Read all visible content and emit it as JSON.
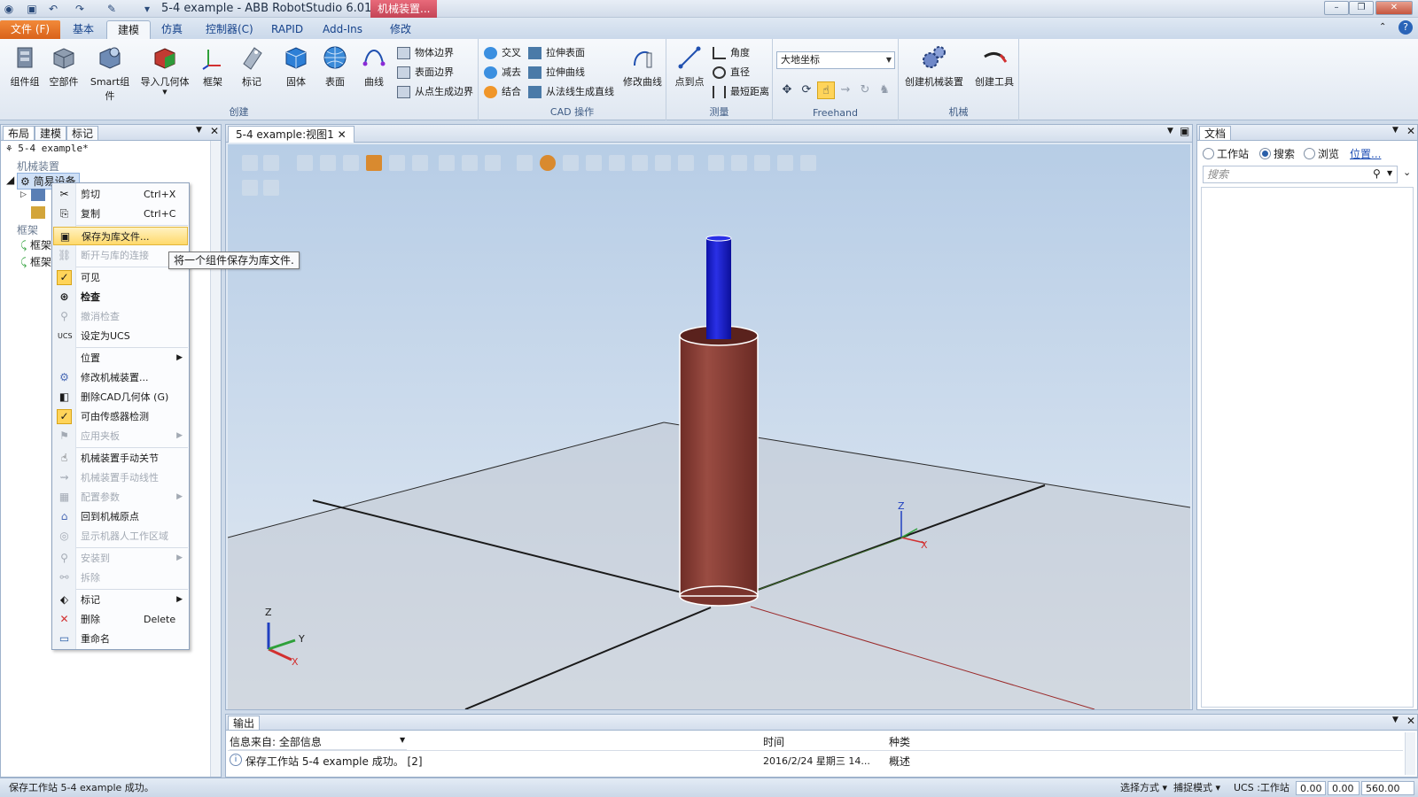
{
  "window": {
    "title": "5-4 example - ABB RobotStudio 6.01.01",
    "context_tab": "机械装置...",
    "buttons": [
      "–",
      "❐",
      "✕"
    ]
  },
  "ribbon_tabs": [
    "文件 (F)",
    "基本",
    "建模",
    "仿真",
    "控制器(C)",
    "RAPID",
    "Add-Ins",
    "修改"
  ],
  "ribbon": {
    "create": {
      "label": "创建",
      "big_buttons": [
        "组件组",
        "空部件",
        "Smart组件",
        "导入几何体",
        "框架",
        "标记"
      ]
    },
    "cad": {
      "label": "CAD 操作",
      "big_buttons": [
        "固体",
        "表面",
        "曲线"
      ],
      "small_col1": [
        "物体边界",
        "表面边界",
        "从点生成边界"
      ],
      "small_col2": [
        "交叉",
        "减去",
        "结合"
      ],
      "small_col3": [
        "拉伸表面",
        "拉伸曲线",
        "从法线生成直线"
      ],
      "modify_curve": "修改曲线"
    },
    "measure": {
      "label": "测量",
      "point_to_point": "点到点",
      "small": [
        "角度",
        "直径",
        "最短距离"
      ]
    },
    "freehand": {
      "label": "Freehand",
      "coord_select": "大地坐标"
    },
    "mechanism": {
      "label": "机械",
      "buttons": [
        "创建机械装置",
        "创建工具"
      ]
    }
  },
  "left_panel": {
    "tabs": [
      "布局",
      "建模",
      "标记"
    ],
    "tree": {
      "station": "5-4 example*",
      "mechanisms": "机械装置",
      "selected": "简易设备",
      "frames": "框架",
      "frame1": "框架",
      "frame2": "框架"
    }
  },
  "context_menu": {
    "items": [
      {
        "label": "剪切",
        "shortcut": "Ctrl+X"
      },
      {
        "label": "复制",
        "shortcut": "Ctrl+C"
      },
      {
        "label": "保存为库文件..."
      },
      {
        "label": "断开与库的连接"
      },
      {
        "label": "可见"
      },
      {
        "label": "检查"
      },
      {
        "label": "撤消检查"
      },
      {
        "label": "设定为UCS"
      },
      {
        "label": "位置"
      },
      {
        "label": "修改机械装置..."
      },
      {
        "label": "删除CAD几何体 (G)"
      },
      {
        "label": "可由传感器检测"
      },
      {
        "label": "应用夹板"
      },
      {
        "label": "机械装置手动关节"
      },
      {
        "label": "机械装置手动线性"
      },
      {
        "label": "配置参数"
      },
      {
        "label": "回到机械原点"
      },
      {
        "label": "显示机器人工作区域"
      },
      {
        "label": "安装到"
      },
      {
        "label": "拆除"
      },
      {
        "label": "标记"
      },
      {
        "label": "删除",
        "shortcut": "Delete"
      },
      {
        "label": "重命名"
      }
    ],
    "tooltip": "将一个组件保存为库文件."
  },
  "viewport": {
    "tab": "5-4 example:视图1",
    "axes_small": {
      "x": "X",
      "y": "Y",
      "z": "Z"
    },
    "axes_world": {
      "x": "X",
      "z": "Z"
    }
  },
  "right_panel": {
    "title": "文档",
    "radios": [
      "工作站",
      "搜索",
      "浏览"
    ],
    "selected_radio": "搜索",
    "location_link": "位置...",
    "search_placeholder": "搜索"
  },
  "output": {
    "title": "输出",
    "filter_label": "信息来自: 全部信息",
    "columns": [
      "时间",
      "种类"
    ],
    "row": {
      "message": "保存工作站 5-4 example 成功。 [2]",
      "time": "2016/2/24 星期三 14...",
      "kind": "概述"
    }
  },
  "statusbar": {
    "message": "保存工作站 5-4 example 成功。",
    "select_mode": "选择方式 ▾",
    "snap_mode": "捕捉模式 ▾",
    "ucs": "UCS :工作站",
    "coords": [
      "0.00",
      "0.00",
      "560.00"
    ]
  },
  "colors": {
    "file_tab": "#d9621a",
    "context_tab": "#c44456",
    "cylinder_outer": "#8a3d34",
    "cylinder_inner": "#1a1fd6",
    "highlight": "#ffd96b"
  }
}
